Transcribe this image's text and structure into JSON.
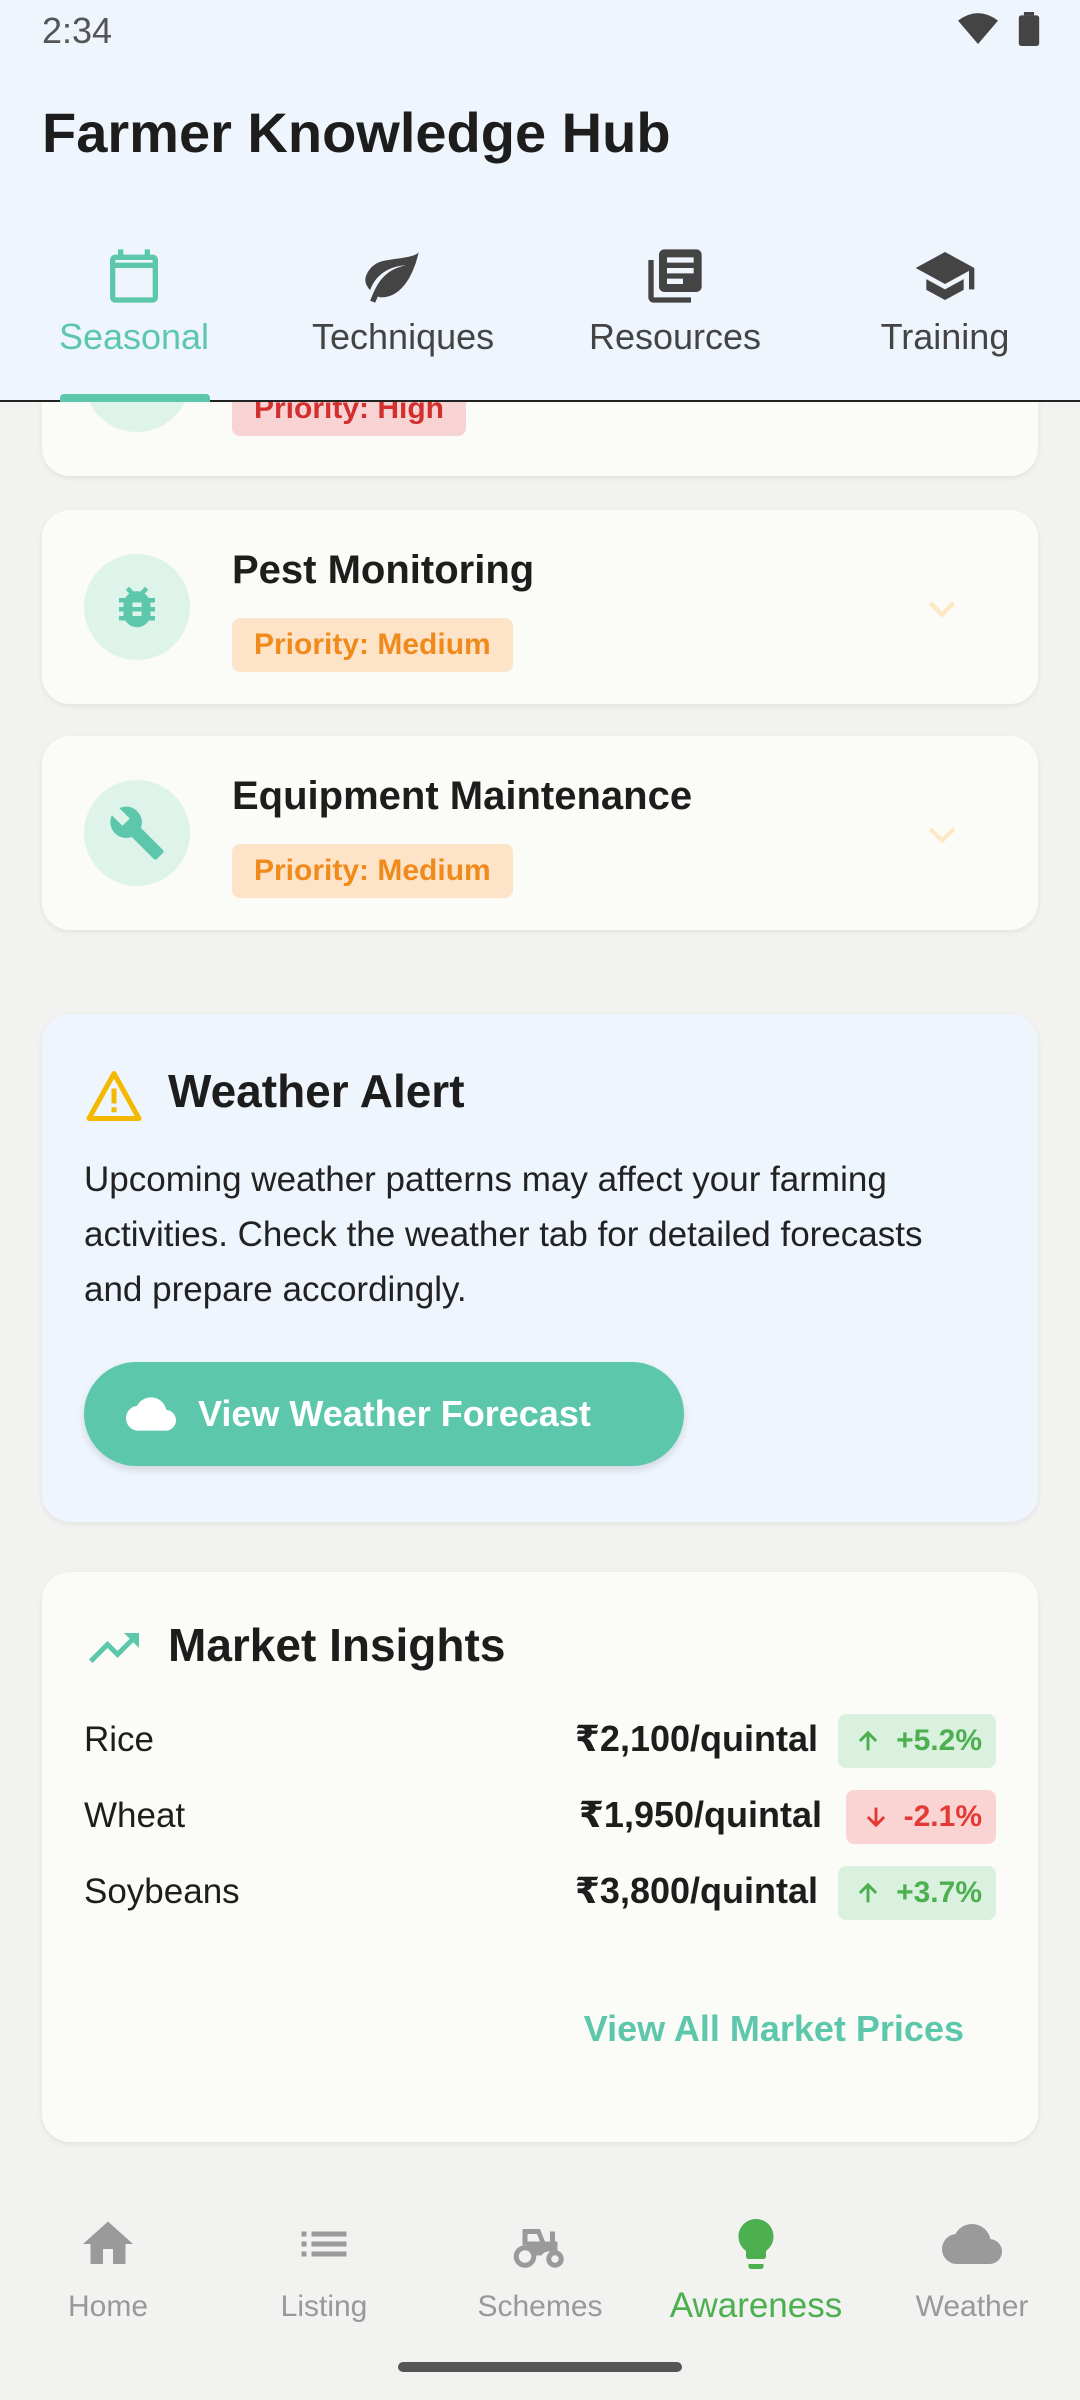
{
  "status_bar": {
    "time": "2:34"
  },
  "app": {
    "title": "Farmer Knowledge Hub"
  },
  "tabs": [
    {
      "label": "Seasonal",
      "icon": "calendar-icon",
      "active": true
    },
    {
      "label": "Techniques",
      "icon": "leaf-icon",
      "active": false
    },
    {
      "label": "Resources",
      "icon": "library-books-icon",
      "active": false
    },
    {
      "label": "Training",
      "icon": "school-icon",
      "active": false
    }
  ],
  "tasks": [
    {
      "title": "",
      "priority": "Priority: High",
      "icon": "task-icon"
    },
    {
      "title": "Pest Monitoring",
      "priority": "Priority: Medium",
      "icon": "bug-icon"
    },
    {
      "title": "Equipment Maintenance",
      "priority": "Priority: Medium",
      "icon": "wrench-icon"
    }
  ],
  "weather_alert": {
    "title": "Weather Alert",
    "text": "Upcoming weather patterns may affect your farming activities. Check the weather tab for detailed forecasts and prepare accordingly.",
    "button": "View Weather Forecast",
    "icon": "warning-icon"
  },
  "market": {
    "title": "Market Insights",
    "icon": "trending-up-icon",
    "rows": [
      {
        "crop": "Rice",
        "price": "₹2,100/quintal",
        "change": "+5.2%",
        "direction": "up"
      },
      {
        "crop": "Wheat",
        "price": "₹1,950/quintal",
        "change": "-2.1%",
        "direction": "down"
      },
      {
        "crop": "Soybeans",
        "price": "₹3,800/quintal",
        "change": "+3.7%",
        "direction": "up"
      }
    ],
    "view_all": "View All Market Prices"
  },
  "bottom_nav": [
    {
      "label": "Home",
      "icon": "home-icon",
      "active": false
    },
    {
      "label": "Listing",
      "icon": "list-icon",
      "active": false
    },
    {
      "label": "Schemes",
      "icon": "tractor-icon",
      "active": false
    },
    {
      "label": "Awareness",
      "icon": "lightbulb-icon",
      "active": true
    },
    {
      "label": "Weather",
      "icon": "cloud-icon",
      "active": false
    }
  ],
  "colors": {
    "accent": "#5dc7ac",
    "active_nav": "#4caf50",
    "header_bg": "#eef5fd"
  }
}
